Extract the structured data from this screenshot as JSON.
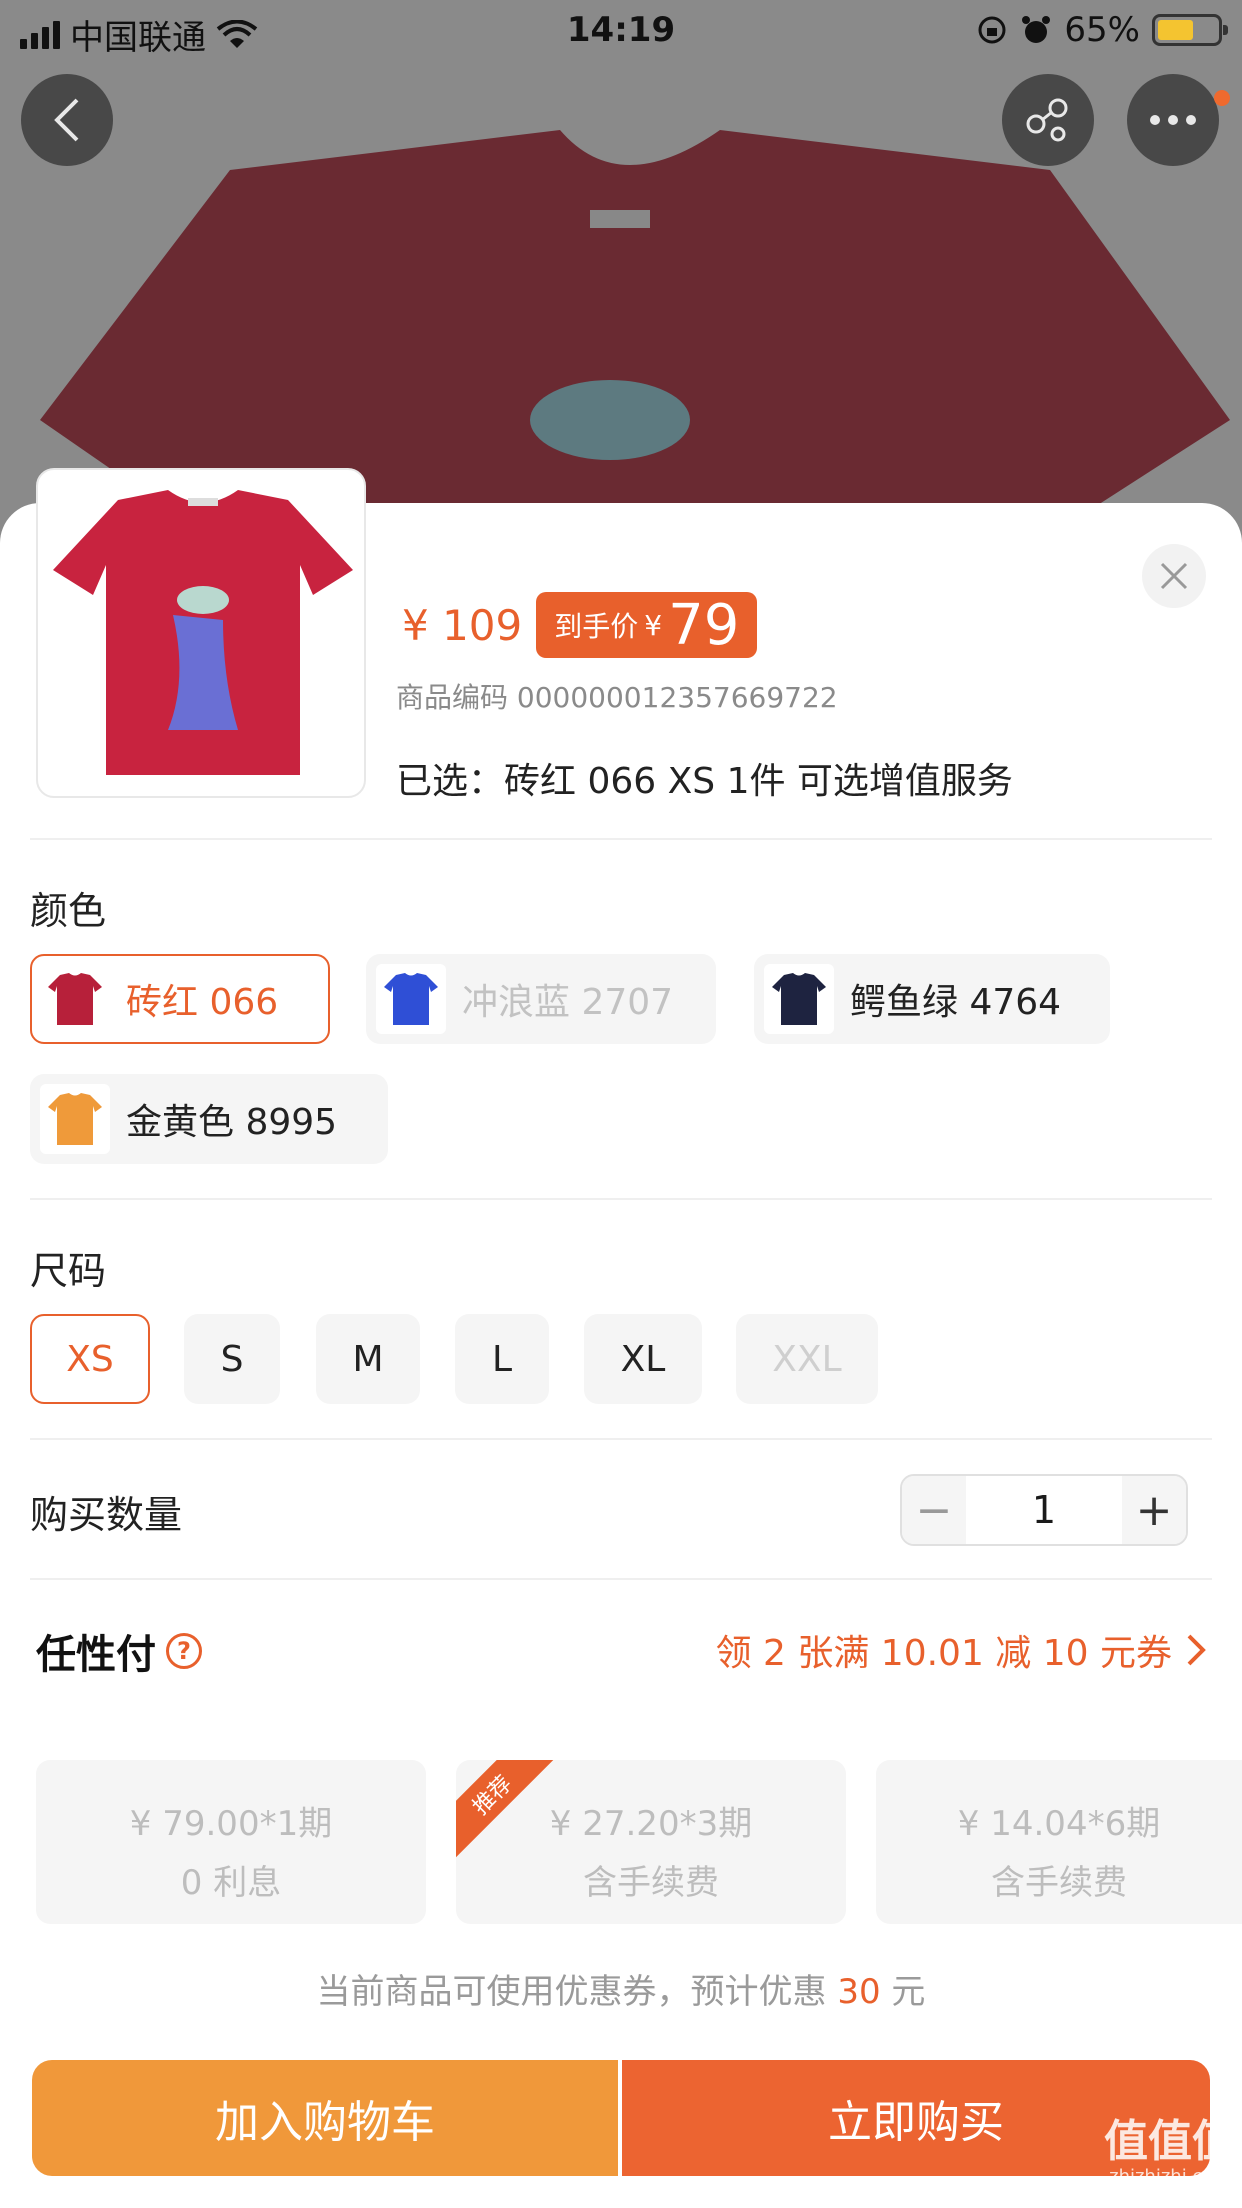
{
  "status_bar": {
    "carrier": "中国联通",
    "time": "14:19",
    "battery": "65%"
  },
  "colors": {
    "accent": "#e8602c",
    "cart_button": "#f0983a",
    "buy_button": "#ec6431",
    "product_red": "#b7203a"
  },
  "product": {
    "original_price": "¥ 109",
    "deal_label": "到手价",
    "deal_currency": "¥",
    "deal_price": "79",
    "sku_label": "商品编码",
    "sku": "000000012357669722",
    "selected_label": "已选：",
    "selected_value": "砖红 066 XS  1件  可选增值服务"
  },
  "color_section": {
    "title": "颜色",
    "options": [
      {
        "label": "砖红 066",
        "state": "selected",
        "shirt_color": "#b7203a"
      },
      {
        "label": "冲浪蓝 2707",
        "state": "disabled",
        "shirt_color": "#2f4fd6"
      },
      {
        "label": "鳄鱼绿 4764",
        "state": "normal",
        "shirt_color": "#1e2340"
      },
      {
        "label": "金黄色 8995",
        "state": "normal",
        "shirt_color": "#ef9a3a"
      }
    ]
  },
  "size_section": {
    "title": "尺码",
    "options": [
      {
        "label": "XS",
        "state": "selected"
      },
      {
        "label": "S",
        "state": "normal"
      },
      {
        "label": "M",
        "state": "normal"
      },
      {
        "label": "L",
        "state": "normal"
      },
      {
        "label": "XL",
        "state": "normal"
      },
      {
        "label": "XXL",
        "state": "disabled"
      }
    ]
  },
  "quantity": {
    "title": "购买数量",
    "value": "1",
    "minus": "−",
    "plus": "+"
  },
  "installment": {
    "title": "任性付",
    "coupon_text": "领 2 张满 10.01 减 10 元券",
    "plans": [
      {
        "line1": "¥ 79.00*1期",
        "line2": "0 利息",
        "badge": ""
      },
      {
        "line1": "¥ 27.20*3期",
        "line2": "含手续费",
        "badge": "推荐"
      },
      {
        "line1": "¥ 14.04*6期",
        "line2": "含手续费",
        "badge": ""
      }
    ]
  },
  "coupon_note": {
    "prefix": "当前商品可使用优惠券，预计优惠 ",
    "amount": "30",
    "suffix": " 元"
  },
  "actions": {
    "add_to_cart": "加入购物车",
    "buy_now": "立即购买"
  },
  "watermark": {
    "main": "值值值",
    "sub": "zhizhizhi.com"
  }
}
